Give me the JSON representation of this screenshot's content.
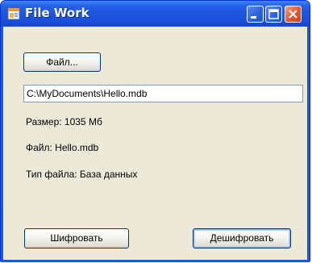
{
  "window": {
    "title": "File Work",
    "controls": [
      "minimize",
      "maximize",
      "close"
    ]
  },
  "form": {
    "file_button_label": "Файл...",
    "path_value": "C:\\MyDocuments\\Hello.mdb",
    "size_label": "Размер: 1035 Мб",
    "file_label": "Файл: Hello.mdb",
    "type_label": "Тип файла: База данных",
    "encrypt_button_label": "Шифровать",
    "decrypt_button_label": "Дешифровать"
  },
  "colors": {
    "titlebar": "#1d55df",
    "client_background": "#ece9d8",
    "close_button": "#e2572f"
  }
}
